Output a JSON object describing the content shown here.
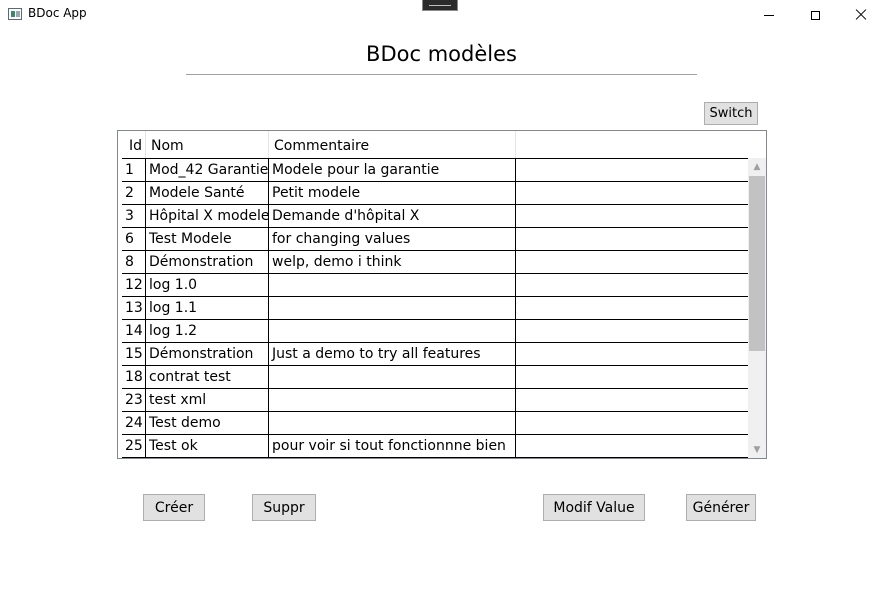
{
  "window": {
    "title": "BDoc App",
    "minimize_icon": "minimize-icon",
    "maximize_icon": "maximize-icon",
    "close_icon": "close-icon"
  },
  "header": {
    "title": "BDoc modèles"
  },
  "toolbar": {
    "switch_label": "Switch"
  },
  "grid": {
    "columns": [
      "Id",
      "Nom",
      "Commentaire",
      ""
    ],
    "rows": [
      {
        "id": "1",
        "nom": "Mod_42 Garantie",
        "commentaire": "Modele pour la garantie"
      },
      {
        "id": "2",
        "nom": "Modele Santé",
        "commentaire": "Petit modele"
      },
      {
        "id": "3",
        "nom": "Hôpital X modele",
        "commentaire": "Demande d'hôpital X"
      },
      {
        "id": "6",
        "nom": "Test Modele",
        "commentaire": "for changing values"
      },
      {
        "id": "8",
        "nom": "Démonstration",
        "commentaire": "welp, demo i think"
      },
      {
        "id": "12",
        "nom": "log 1.0",
        "commentaire": ""
      },
      {
        "id": "13",
        "nom": "log 1.1",
        "commentaire": ""
      },
      {
        "id": "14",
        "nom": "log 1.2",
        "commentaire": ""
      },
      {
        "id": "15",
        "nom": "Démonstration",
        "commentaire": "Just a demo to try all features"
      },
      {
        "id": "18",
        "nom": "contrat test",
        "commentaire": ""
      },
      {
        "id": "23",
        "nom": "test xml",
        "commentaire": ""
      },
      {
        "id": "24",
        "nom": "Test demo",
        "commentaire": ""
      },
      {
        "id": "25",
        "nom": "Test ok",
        "commentaire": "pour voir si tout fonctionnne bien"
      }
    ]
  },
  "actions": {
    "creer_label": "Créer",
    "suppr_label": "Suppr",
    "modif_label": "Modif Value",
    "generer_label": "Générer"
  },
  "colors": {
    "button_bg": "#e1e1e1",
    "button_border": "#adadad",
    "grid_border": "#828790",
    "scrollbar_thumb": "#c2c2c2"
  }
}
